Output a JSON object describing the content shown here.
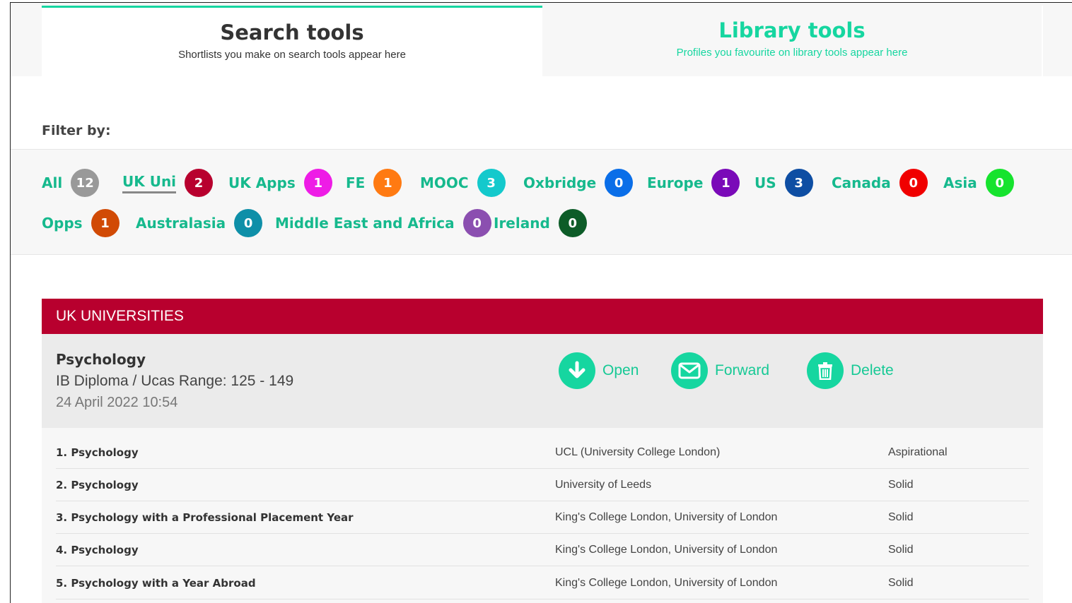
{
  "tabs": [
    {
      "title": "Search tools",
      "subtitle": "Shortlists you make on search tools appear here",
      "active": true
    },
    {
      "title": "Library tools",
      "subtitle": "Profiles you favourite on library tools appear here",
      "active": false
    }
  ],
  "filter": {
    "label": "Filter by:",
    "chips": [
      {
        "label": "All",
        "count": "12",
        "color": "#999999"
      },
      {
        "label": "UK Uni",
        "count": "2",
        "color": "#b8002e",
        "active": true
      },
      {
        "label": "UK Apps",
        "count": "1",
        "color": "#ee1ce6"
      },
      {
        "label": "FE",
        "count": "1",
        "color": "#ff7a12"
      },
      {
        "label": "MOOC",
        "count": "3",
        "color": "#14c9cc"
      },
      {
        "label": "Oxbridge",
        "count": "0",
        "color": "#0a6ee8"
      },
      {
        "label": "Europe",
        "count": "1",
        "color": "#7a0ab8"
      },
      {
        "label": "US",
        "count": "3",
        "color": "#0e4ea3"
      },
      {
        "label": "Canada",
        "count": "0",
        "color": "#f00000"
      },
      {
        "label": "Asia",
        "count": "0",
        "color": "#16e32e"
      },
      {
        "label": "Opps",
        "count": "1",
        "color": "#d14a05"
      },
      {
        "label": "Australasia",
        "count": "0",
        "color": "#0e8fa8"
      },
      {
        "label": "Middle East and Africa",
        "count": "0",
        "color": "#8b4fb0"
      },
      {
        "label": "Ireland",
        "count": "0",
        "color": "#0d5c28"
      }
    ]
  },
  "section": {
    "header": "UK UNIVERSITIES",
    "entry": {
      "title": "Psychology",
      "subtitle": "IB Diploma / Ucas Range: 125 - 149",
      "date": "24 April 2022 10:54",
      "actions": [
        {
          "label": "Open",
          "icon": "download-arrow-icon"
        },
        {
          "label": "Forward",
          "icon": "envelope-icon"
        },
        {
          "label": "Delete",
          "icon": "trash-icon"
        }
      ]
    },
    "rows": [
      {
        "course": "1. Psychology",
        "university": "UCL (University College London)",
        "status": "Aspirational"
      },
      {
        "course": "2. Psychology",
        "university": "University of Leeds",
        "status": "Solid"
      },
      {
        "course": "3. Psychology with a Professional Placement Year",
        "university": "King's College London, University of London",
        "status": "Solid"
      },
      {
        "course": "4. Psychology",
        "university": "King's College London, University of London",
        "status": "Solid"
      },
      {
        "course": "5. Psychology with a Year Abroad",
        "university": "King's College London, University of London",
        "status": "Solid"
      }
    ]
  }
}
